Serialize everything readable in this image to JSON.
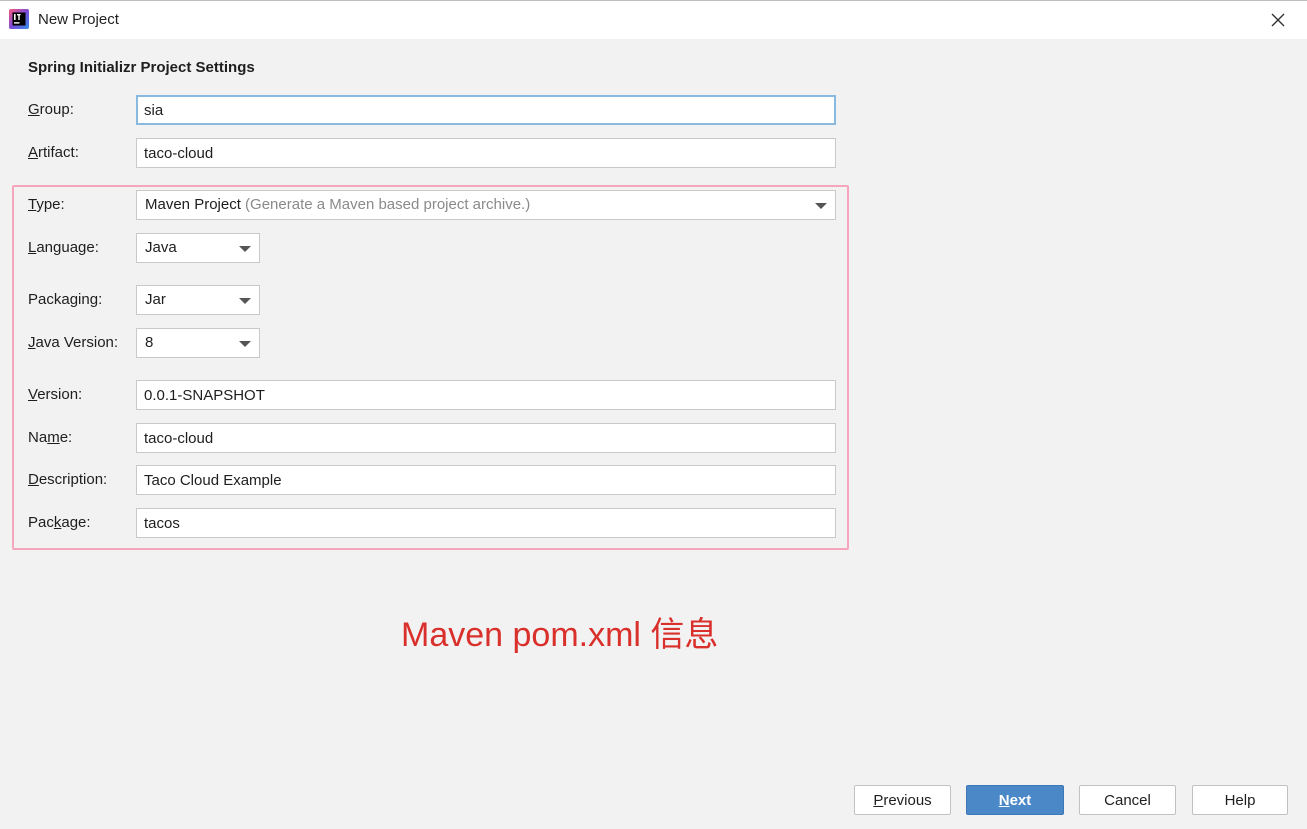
{
  "window": {
    "title": "New Project",
    "app_icon": "intellij-idea-icon",
    "close_icon": "close-icon"
  },
  "form": {
    "section_title": "Spring Initializr Project Settings",
    "group": {
      "mnemonic": "G",
      "rest": "roup:",
      "value": "sia"
    },
    "artifact": {
      "mnemonic": "A",
      "rest": "rtifact:",
      "value": "taco-cloud"
    },
    "type": {
      "mnemonic": "T",
      "rest": "ype:",
      "value": "Maven Project",
      "hint": "(Generate a Maven based project archive.)"
    },
    "language": {
      "mnemonic": "L",
      "rest": "anguage:",
      "value": "Java"
    },
    "packaging": {
      "pre": "Packa",
      "mnemonic": "g",
      "rest": "ing:",
      "value": "Jar"
    },
    "java_version": {
      "mnemonic": "J",
      "rest": "ava Version:",
      "value": "8"
    },
    "version": {
      "mnemonic": "V",
      "rest": "ersion:",
      "value": "0.0.1-SNAPSHOT"
    },
    "name": {
      "pre": "Na",
      "mnemonic": "m",
      "rest": "e:",
      "value": "taco-cloud"
    },
    "description": {
      "mnemonic": "D",
      "rest": "escription:",
      "value": "Taco Cloud Example"
    },
    "package": {
      "pre": "Pac",
      "mnemonic": "k",
      "rest": "age:",
      "value": "tacos"
    }
  },
  "annotation": {
    "text": "Maven pom.xml 信息",
    "color": "#d9302c",
    "box_color": "#f5a6bd"
  },
  "buttons": {
    "previous": {
      "mnemonic": "P",
      "rest": "revious"
    },
    "next": {
      "mnemonic": "N",
      "rest": "ext"
    },
    "cancel": {
      "label": "Cancel"
    },
    "help": {
      "label": "Help"
    }
  },
  "colors": {
    "primary_button": "#4a88c8",
    "focus_ring": "#8ab9e0"
  }
}
